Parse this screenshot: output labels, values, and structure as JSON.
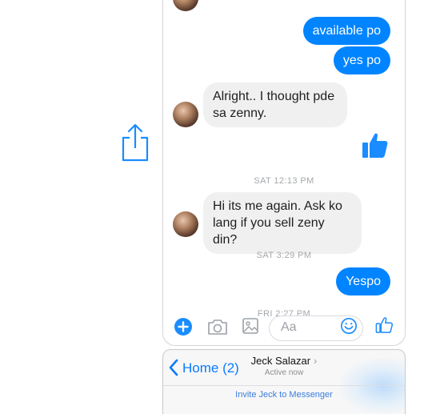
{
  "messages": {
    "m1": "available po",
    "m2": "yes po",
    "m3": "Alright.. I thought pde sa zenny.",
    "m4": "Hi its me again. Ask ko lang if you sell zeny din?",
    "m5": "Yespo"
  },
  "timestamps": {
    "t1": "SAT 12:13 PM",
    "t2": "SAT 3:29 PM",
    "t3": "FRI 2:27 PM"
  },
  "composer": {
    "placeholder": "Aa"
  },
  "nav": {
    "back_label": "Home (2)",
    "contact_name": "Jeck Salazar",
    "status": "Active now",
    "invite_label": "Invite Jeck to Messenger"
  },
  "colors": {
    "accent": "#0084ff",
    "incoming_bubble": "#f1f0f0",
    "link": "#0a7bff"
  },
  "icons": [
    "share-icon",
    "avatar",
    "thumbs-up-icon",
    "plus-icon",
    "camera-icon",
    "image-icon",
    "emoji-icon",
    "chevron-left-icon",
    "chevron-right-icon"
  ]
}
